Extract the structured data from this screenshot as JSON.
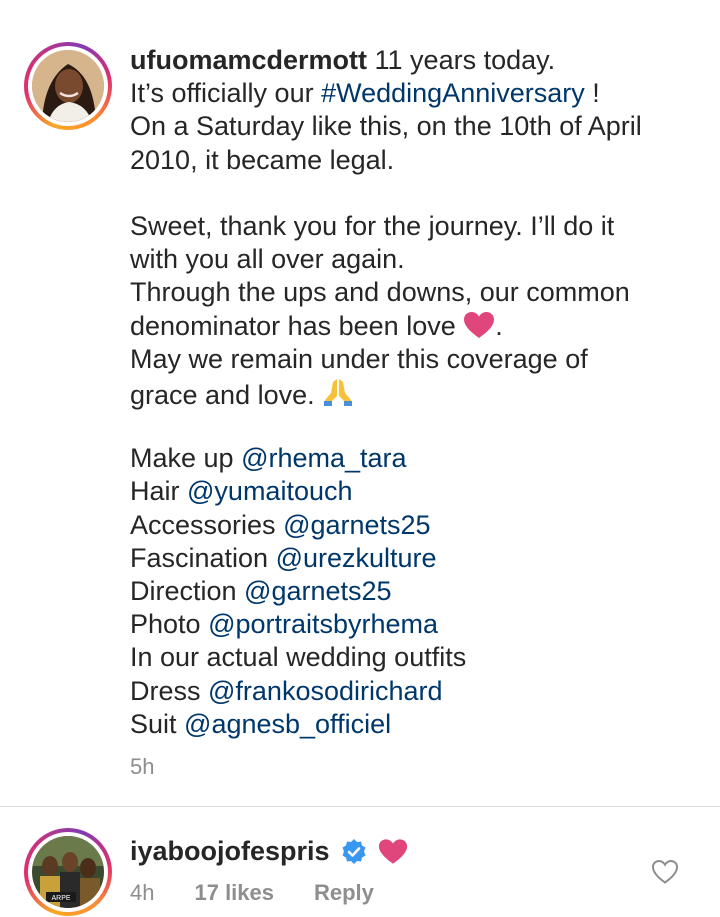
{
  "post": {
    "username": "ufuomamcdermott",
    "lines": [
      " 11 years today.",
      "It’s officially our ",
      "#WeddingAnniversary",
      " !",
      "On a Saturday like this, on the 10th of April",
      "2010, it became legal.",
      "Sweet, thank you for the journey. I’ll do it",
      "with you all over again.",
      "Through the ups and downs, our common",
      "denominator has been love ",
      ".",
      "May we remain under this coverage of",
      "grace and love. "
    ],
    "credits": [
      {
        "label": "Make up ",
        "handle": "@rhema_tara"
      },
      {
        "label": "Hair ",
        "handle": "@yumaitouch"
      },
      {
        "label": "Accessories ",
        "handle": "@garnets25"
      },
      {
        "label": "Fascination ",
        "handle": "@urezkulture"
      },
      {
        "label": "Direction ",
        "handle": "@garnets25"
      },
      {
        "label": "Photo ",
        "handle": "@portraitsbyrhema"
      }
    ],
    "outfits_line": "In our actual wedding outfits",
    "outfit_credits": [
      {
        "label": "Dress ",
        "handle": "@frankosodirichard"
      },
      {
        "label": "Suit ",
        "handle": "@agnesb_officiel"
      }
    ],
    "time": "5h"
  },
  "comment": {
    "username": "iyaboojofespris",
    "time": "4h",
    "likes": "17 likes",
    "reply_label": "Reply"
  },
  "colors": {
    "link": "#00376b",
    "text": "#262626",
    "muted": "#8e8e8e",
    "heart": "#e0457b",
    "verified": "#3897f0"
  },
  "icons": {
    "verified": "verified-badge-icon",
    "heart": "heart-emoji-icon",
    "pray": "praying-hands-emoji-icon",
    "like": "heart-outline-icon"
  }
}
